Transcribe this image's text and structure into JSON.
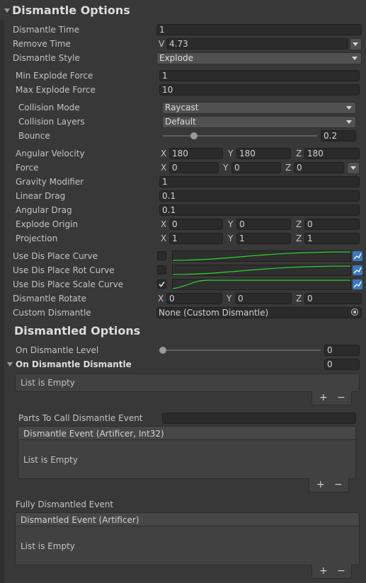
{
  "dismantle_options": {
    "title": "Dismantle Options",
    "dismantle_time": {
      "label": "Dismantle Time",
      "value": "1"
    },
    "remove_time": {
      "label": "Remove Time",
      "prefix": "V",
      "value": "4.73"
    },
    "dismantle_style": {
      "label": "Dismantle Style",
      "value": "Explode"
    },
    "min_explode_force": {
      "label": "Min Explode Force",
      "value": "1"
    },
    "max_explode_force": {
      "label": "Max Explode Force",
      "value": "10"
    },
    "collision_mode": {
      "label": "Collision Mode",
      "value": "Raycast"
    },
    "collision_layers": {
      "label": "Collision Layers",
      "value": "Default"
    },
    "bounce": {
      "label": "Bounce",
      "value": "0.2",
      "level": 0.2
    },
    "angular_velocity": {
      "label": "Angular Velocity",
      "x": "180",
      "y": "180",
      "z": "180"
    },
    "force": {
      "label": "Force",
      "x": "0",
      "y": "0",
      "z": "0"
    },
    "gravity_modifier": {
      "label": "Gravity Modifier",
      "value": "1"
    },
    "linear_drag": {
      "label": "Linear Drag",
      "value": "0.1"
    },
    "angular_drag": {
      "label": "Angular Drag",
      "value": "0.1"
    },
    "explode_origin": {
      "label": "Explode Origin",
      "x": "0",
      "y": "0",
      "z": "0"
    },
    "projection": {
      "label": "Projection",
      "x": "1",
      "y": "1",
      "z": "1"
    },
    "use_dis_place_curve": {
      "label": "Use Dis Place Curve",
      "checked": false
    },
    "use_dis_place_rot_curve": {
      "label": "Use Dis Place Rot Curve",
      "checked": false
    },
    "use_dis_place_scale_curve": {
      "label": "Use Dis Place Scale Curve",
      "checked": true
    },
    "dismantle_rotate": {
      "label": "Dismantle Rotate",
      "x": "0",
      "y": "0",
      "z": "0"
    },
    "custom_dismantle": {
      "label": "Custom Dismantle",
      "value": "None (Custom Dismantle)"
    }
  },
  "axis_labels": {
    "x": "X",
    "y": "Y",
    "z": "Z"
  },
  "dismantled_options": {
    "title": "Dismantled Options",
    "on_dismantle_level": {
      "label": "On Dismantle Level",
      "value": "0",
      "level": 0
    },
    "on_dismantle_dismantle": {
      "label": "On Dismantle Dismantle",
      "count": "0",
      "empty_text": "List is Empty"
    },
    "parts_to_call": {
      "label": "Parts To Call Dismantle Event",
      "value": ""
    },
    "dismantle_event": {
      "header": "Dismantle Event (Artificer, Int32)",
      "empty_text": "List is Empty"
    },
    "fully_dismantled": {
      "label": "Fully Dismantled Event",
      "header": "Dismantled Event (Artificer)",
      "empty_text": "List is Empty"
    }
  },
  "list_controls": {
    "add": "+",
    "remove": "−"
  },
  "colors": {
    "background": "#383838",
    "field": "#2a2a2a",
    "curve_line": "#2fd12f",
    "curve_button": "#3b79c2"
  }
}
